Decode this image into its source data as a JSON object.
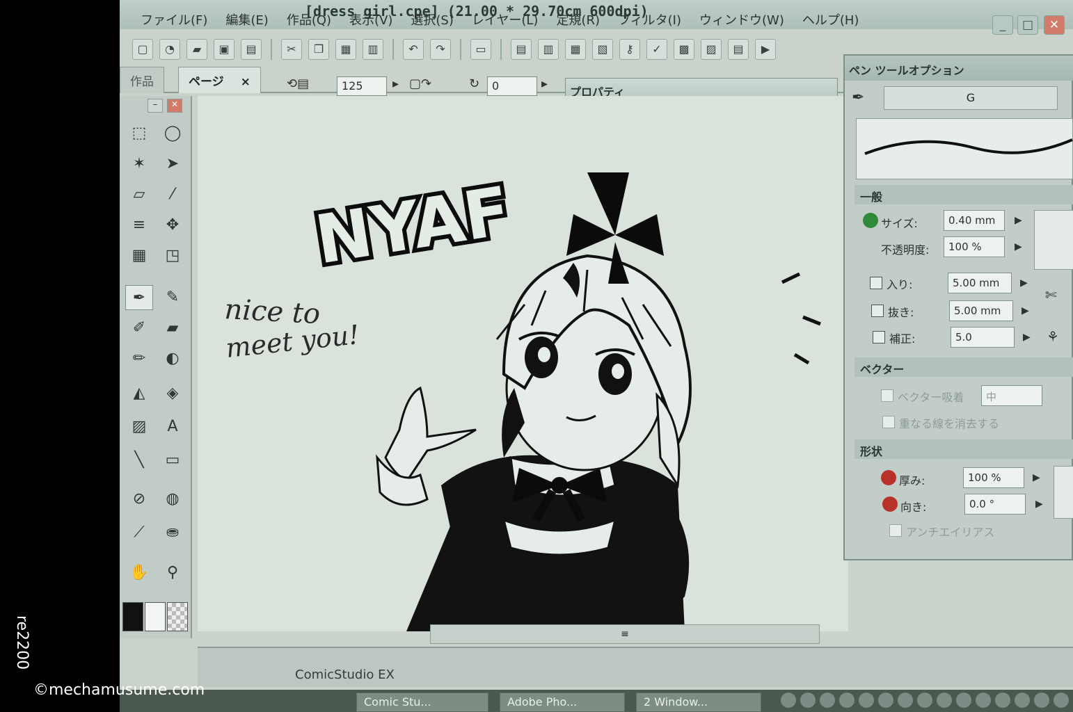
{
  "window": {
    "title": "[dress girl.cpe] (21.00 * 29.70cm 600dpi)",
    "controls": [
      "_",
      "□",
      "✕"
    ]
  },
  "menu": [
    "ファイル(F)",
    "編集(E)",
    "作品(Q)",
    "表示(V)",
    "選択(S)",
    "レイヤー(L)",
    "定規(R)",
    "フィルタ(I)",
    "ウィンドウ(W)",
    "ヘルプ(H)"
  ],
  "tabs": {
    "works_label": "作品",
    "page_label": "ページ",
    "page_close": "×",
    "zoom_value": "125",
    "rotation_value": "0"
  },
  "property_window": {
    "title": "プロパティ"
  },
  "canvas": {
    "sound_effect_text": "NYAF",
    "handwritten_line1": "nice to",
    "handwritten_line2": "meet you!"
  },
  "statusbar": {
    "app_name": "ComicStudio EX"
  },
  "taskbar": {
    "items": [
      "Comic Stu...",
      "Adobe Pho...",
      "2 Window..."
    ]
  },
  "pen_panel": {
    "title": "ペン ツールオプション",
    "preset_name": "G",
    "section_general": "一般",
    "size_label": "サイズ:",
    "size_value": "0.40 mm",
    "opacity_label": "不透明度:",
    "opacity_value": "100 %",
    "in_label": "入り:",
    "in_value": "5.00 mm",
    "out_label": "抜き:",
    "out_value": "5.00 mm",
    "correction_label": "補正:",
    "correction_value": "5.0",
    "section_vector": "ベクター",
    "vector_snap_label": "ベクター吸着",
    "vector_snap_value": "中",
    "remove_overlap_label": "重なる線を消去する",
    "section_shape": "形状",
    "thickness_label": "厚み:",
    "thickness_value": "100 %",
    "direction_label": "向き:",
    "direction_value": "0.0 °",
    "antialias_label": "アンチエイリアス"
  },
  "watermark": {
    "vertical": "re2200",
    "bottom": "©mechamusume.com"
  }
}
